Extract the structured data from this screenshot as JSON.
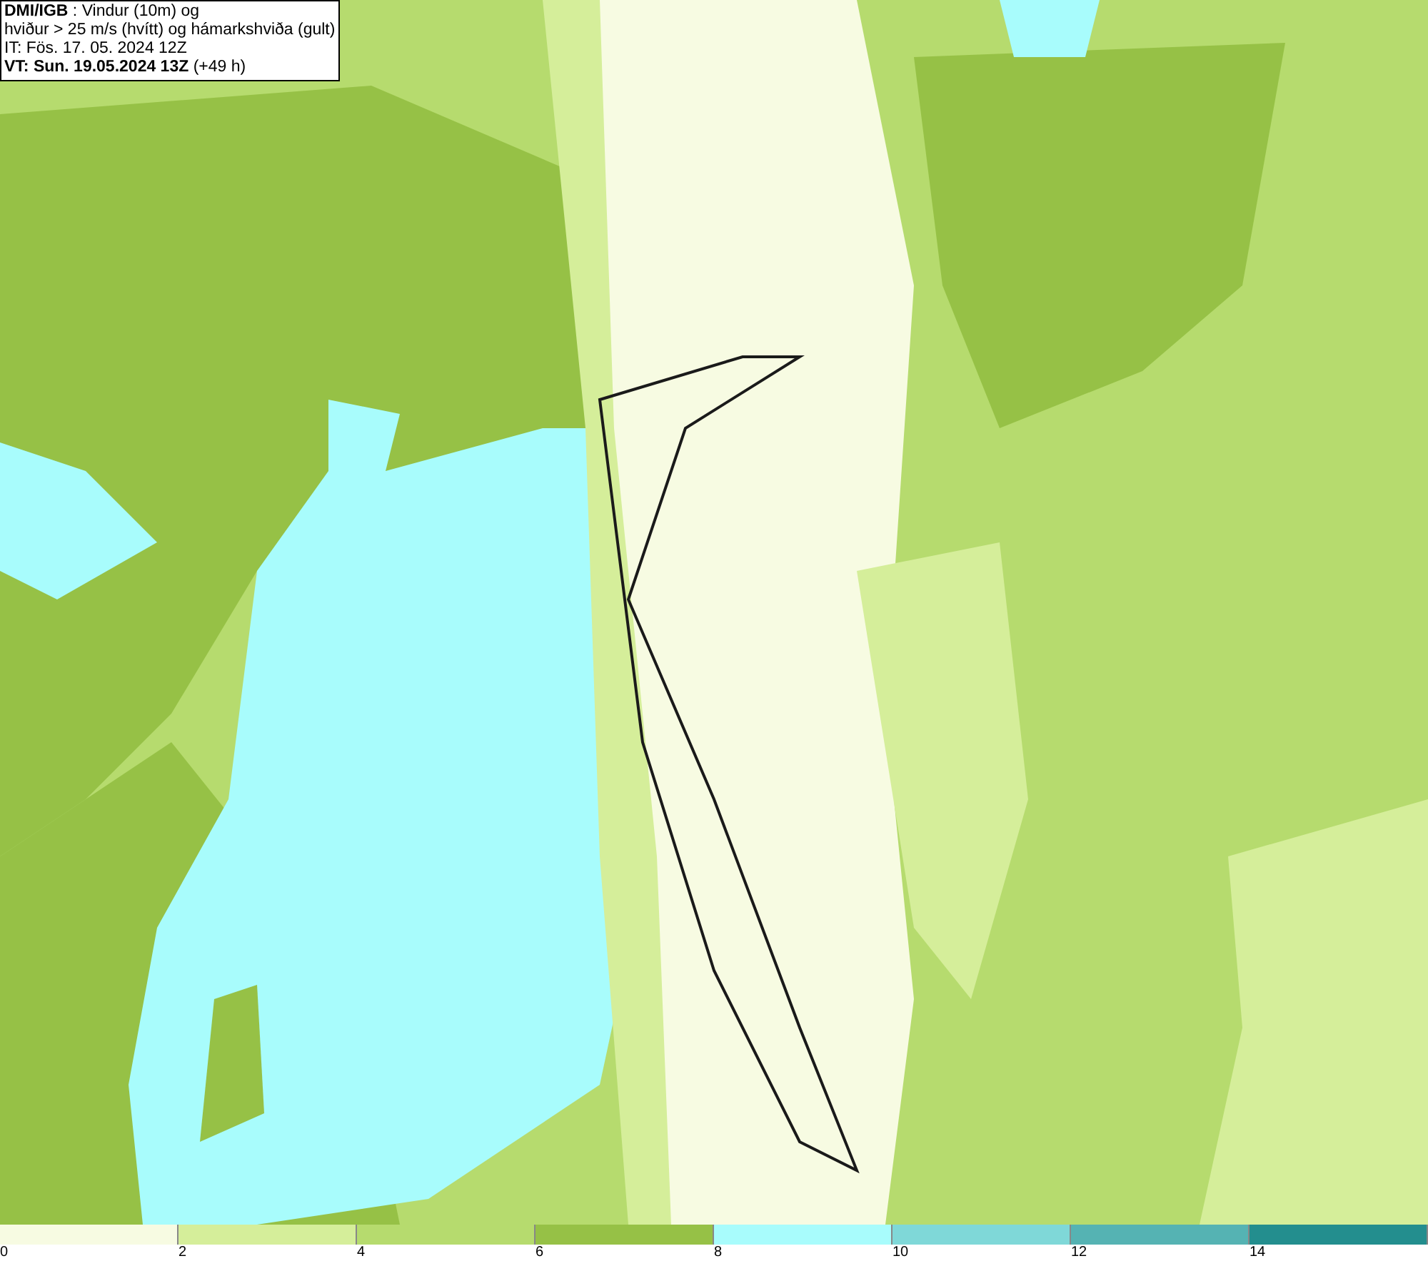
{
  "info_box": {
    "lines": [
      "**DMI/IGB** : Vindur (10m) og",
      "hviður > 25 m/s (hvítt) og hámarkshviða (gult)",
      "IT: Fös. 17. 05. 2024 12Z",
      "**VT: Sun. 19.05.2024 13Z** (+49 h)"
    ]
  },
  "legend": {
    "bins": [
      {
        "label": "0",
        "color": "#f7fbe2"
      },
      {
        "label": "2",
        "color": "#d5ee9a"
      },
      {
        "label": "4",
        "color": "#b6db6e"
      },
      {
        "label": "6",
        "color": "#96c146"
      },
      {
        "label": "8",
        "color": "#a8fcfc"
      },
      {
        "label": "10",
        "color": "#7fd8d8"
      },
      {
        "label": "12",
        "color": "#55b3b3"
      },
      {
        "label": "14",
        "color": "#238e8e"
      }
    ]
  }
}
